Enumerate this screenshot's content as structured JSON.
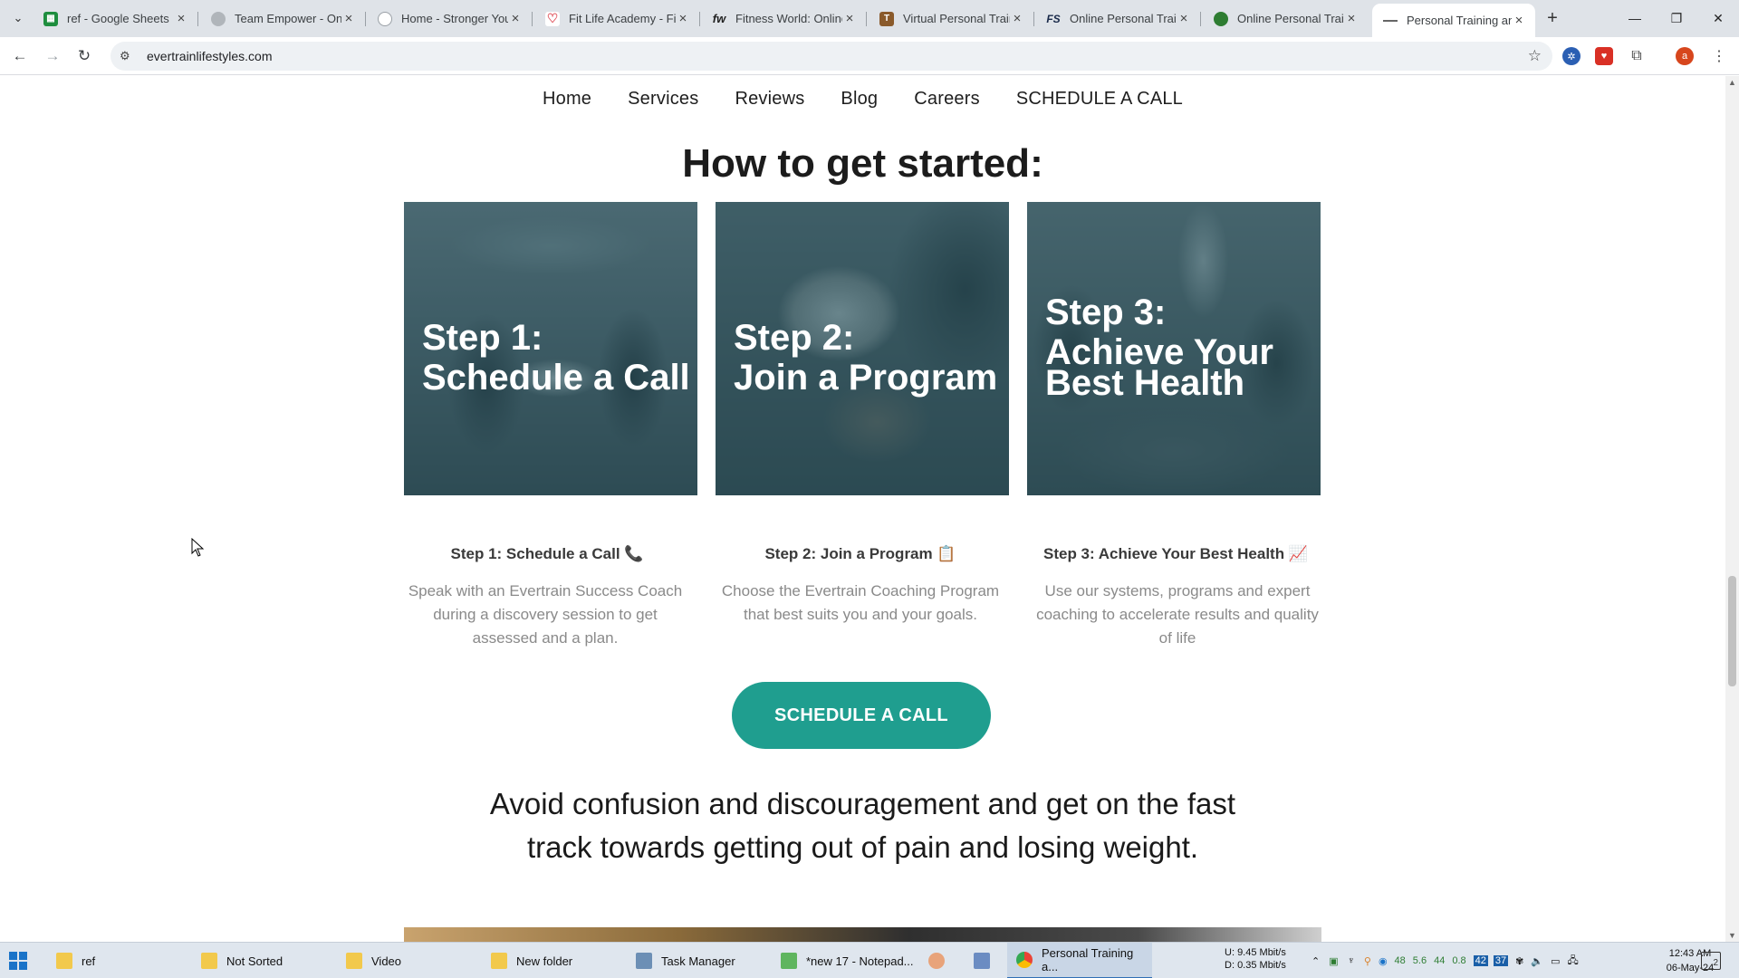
{
  "browser": {
    "tabs": [
      {
        "title": "ref - Google Sheets",
        "icon": "sheets-icon",
        "color": "#1e8e3e"
      },
      {
        "title": "Team Empower - Onl",
        "icon": "empower-icon",
        "color": "#9aa0a6"
      },
      {
        "title": "Home - Stronger You",
        "icon": "globe-icon",
        "color": "#9aa0a6"
      },
      {
        "title": "Fit Life Academy - Fit",
        "icon": "fitlife-icon",
        "color": "#e15b64"
      },
      {
        "title": "Fitness World: Online",
        "icon": "fw-icon",
        "color": "#222222"
      },
      {
        "title": "Virtual Personal Train",
        "icon": "vpt-icon",
        "color": "#8a5a2b"
      },
      {
        "title": "Online Personal Train",
        "icon": "fs-icon",
        "color": "#1a2a4a"
      },
      {
        "title": "Online Personal Train",
        "icon": "leaf-icon",
        "color": "#2e7d32"
      },
      {
        "title": "Personal Training and",
        "icon": "evertrain-icon",
        "color": "#555555",
        "active": true
      }
    ],
    "url": "evertrainlifestyles.com",
    "profile_initial": "a"
  },
  "site": {
    "nav": [
      "Home",
      "Services",
      "Reviews",
      "Blog",
      "Careers",
      "SCHEDULE A CALL"
    ],
    "heading": "How to get started:",
    "cards": [
      {
        "line1": "Step 1:",
        "line2": "Schedule a Call",
        "line3": ""
      },
      {
        "line1": "Step 2:",
        "line2": "Join a Program",
        "line3": ""
      },
      {
        "line1": "Step 3:",
        "line2": "Achieve Your",
        "line3": "Best Health"
      }
    ],
    "steps": [
      {
        "title": "Step 1: Schedule a Call 📞",
        "desc": "Speak with an Evertrain Success Coach during a discovery session to get assessed and a plan."
      },
      {
        "title": "Step 2: Join a Program 📋",
        "desc": "Choose the Evertrain Coaching Program that best suits you and your goals."
      },
      {
        "title": "Step 3: Achieve Your Best Health 📈",
        "desc": "Use our systems, programs and expert coaching to accelerate results and quality of life"
      }
    ],
    "cta_label": "SCHEDULE A CALL",
    "headline": "Avoid confusion and discouragement and get on the fast track towards getting out of pain and losing weight.",
    "accent_color": "#1f9e8f"
  },
  "taskbar": {
    "items": [
      {
        "label": "ref",
        "icon": "folder-icon"
      },
      {
        "label": "Not Sorted",
        "icon": "folder-icon"
      },
      {
        "label": "Video",
        "icon": "folder-icon"
      },
      {
        "label": "New folder",
        "icon": "folder-icon"
      },
      {
        "label": "Task Manager",
        "icon": "task-manager-icon"
      },
      {
        "label": "*new 17 - Notepad...",
        "icon": "notepad-icon"
      },
      {
        "label": "Personal Training a...",
        "icon": "chrome-icon",
        "active": true
      }
    ],
    "net_up": "9.45 Mbit/s",
    "net_down": "0.35 Mbit/s",
    "net_up_label": "U:",
    "net_down_label": "D:",
    "tray_values": [
      "48",
      "5.6",
      "44",
      "0.8"
    ],
    "tray_badges": [
      "42",
      "37"
    ],
    "time": "12:43 AM",
    "date": "06-May-24",
    "notification_count": "2"
  }
}
